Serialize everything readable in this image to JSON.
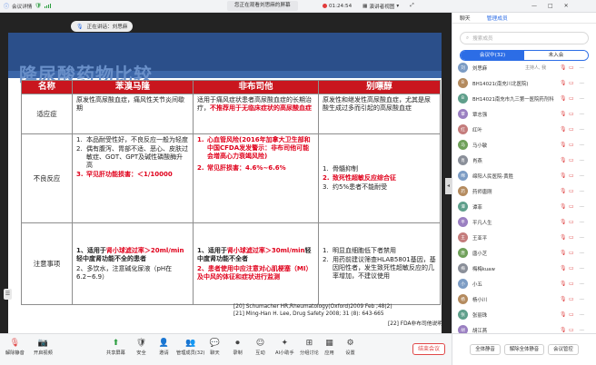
{
  "topbar": {
    "app_label": "会议详情",
    "center_status": "您正在观看刘思麻的屏幕",
    "time": "01:24:54",
    "layout": "演讲者视图",
    "wincontrols": [
      "—",
      "□",
      "✕"
    ]
  },
  "speaker": {
    "label": "正在讲话：刘思麻"
  },
  "slide": {
    "title": "降尿酸药物比较",
    "headers": [
      "名称",
      "苯溴马隆",
      "非布司他",
      "别嘌醇"
    ],
    "rows": [
      {
        "label": "适应症",
        "c1": "原发性高尿酸血症，痛风性关节炎间歇期",
        "c2_plain": "适用于痛风症状患者高尿酸血症的长期治疗，",
        "c2_red": "不推荐用于无临床症状的高尿酸血症",
        "c3": "原发性和继发性高尿酸血症，尤其是尿酸生成过多而引起的高尿酸血症"
      },
      {
        "label": "不良反应",
        "c1_items": [
          {
            "n": "1.",
            "t": "本品耐受性好，不良反应一般为轻度"
          },
          {
            "n": "2.",
            "t": "偶有腹泻、胃部不适、恶心、皮肤过敏症、GOT、GPT及碱性磷酸酶升高"
          },
          {
            "n": "3.",
            "t": "罕见肝功能损害：＜1/10000"
          }
        ],
        "c2_items": [
          {
            "n": "1.",
            "t": "心血管风险(2016年加拿大卫生部和中国CFDA发发警示：非布司他可能会增高心力衰竭风险)"
          },
          {
            "n": "2.",
            "t": "常见肝损害：4.6%~6.6%"
          }
        ],
        "c3_items": [
          {
            "n": "1.",
            "t": "骨髓抑制"
          },
          {
            "n": "2.",
            "t": "致死性超敏反应综合征"
          },
          {
            "n": "3.",
            "t": "约5%患者不能耐受"
          }
        ]
      },
      {
        "label": "注意事项",
        "c1_p1_pre": "1、适用于",
        "c1_p1_red": "肾小球滤过率＞20ml/min",
        "c1_p1_post": "轻中度肾功能不全的患者",
        "c1_p2": "2、多饮水，注意碱化尿液（pH在6.2~6.9）",
        "c2_p1_pre": "1、适用于",
        "c2_p1_red": "肾小球滤过率＞30ml/min",
        "c2_p1_post": "轻中度肾功能不全者",
        "c2_p2": "2、患者使用中应注意对心肌梗塞（MI）及中风的体征和症状进行监测",
        "c3_items": [
          {
            "n": "1.",
            "t": "明显血细胞低下者禁用"
          },
          {
            "n": "2.",
            "t": "用药前建议筛查HLAB5801基因，基因阳性者，发生致死性超敏反应的几率增加，不建议使用"
          }
        ]
      }
    ],
    "refs": [
      "[20] Schumacher HR,Rheumatology(Oxford)2009 Feb ;48(2)",
      "[21] Ming-Han H. Lee, Drug Safety 2008; 31 (8): 643-665"
    ],
    "ref3": "[22] FDA非布司他说明书"
  },
  "toolbar": {
    "items": [
      {
        "label": "解除静音",
        "icon": "mic-icon"
      },
      {
        "label": "开启视频",
        "icon": "camera-icon"
      },
      {
        "label": "共享屏幕",
        "icon": "share-icon"
      },
      {
        "label": "安全",
        "icon": "shield-icon"
      },
      {
        "label": "邀请",
        "icon": "invite-icon"
      },
      {
        "label": "管理成员(32)",
        "icon": "members-icon"
      },
      {
        "label": "聊天",
        "icon": "chat-icon"
      },
      {
        "label": "录制",
        "icon": "record-icon"
      },
      {
        "label": "互动",
        "icon": "interact-icon"
      },
      {
        "label": "AI小助手",
        "icon": "ai-icon"
      },
      {
        "label": "分组讨论",
        "icon": "group-icon"
      },
      {
        "label": "应用",
        "icon": "apps-icon"
      },
      {
        "label": "设置",
        "icon": "settings-icon"
      }
    ],
    "leave": "结束会议"
  },
  "panel": {
    "tabs": [
      "聊天",
      "管理成员"
    ],
    "search_placeholder": "搜索成员",
    "segments": [
      "会议中(32)",
      "未入会"
    ],
    "participants": [
      {
        "name": "刘思麻",
        "status": "主持人, 我",
        "avatar": "刘"
      },
      {
        "name": "BH14021(南充川北医院)",
        "status": "",
        "avatar": "B"
      },
      {
        "name": "BH14021南充市九三第一医院药剂科",
        "status": "",
        "avatar": "B"
      },
      {
        "name": "覃志强",
        "status": "",
        "avatar": "覃"
      },
      {
        "name": "红叶",
        "status": "",
        "avatar": "红"
      },
      {
        "name": "马小敏",
        "status": "",
        "avatar": "马"
      },
      {
        "name": "肖燕",
        "status": "",
        "avatar": "肖"
      },
      {
        "name": "绵阳人民医院-黄胜",
        "status": "",
        "avatar": "绵"
      },
      {
        "name": "药师唐刚",
        "status": "",
        "avatar": "药"
      },
      {
        "name": "谭菲",
        "status": "",
        "avatar": "谭"
      },
      {
        "name": "平凡人生",
        "status": "",
        "avatar": "平"
      },
      {
        "name": "王亚平",
        "status": "",
        "avatar": "王"
      },
      {
        "name": "唐小芝",
        "status": "",
        "avatar": "唐"
      },
      {
        "name": "梅梅kuaw",
        "status": "",
        "avatar": "梅"
      },
      {
        "name": "小五",
        "status": "",
        "avatar": "小"
      },
      {
        "name": "杨小川",
        "status": "",
        "avatar": "杨"
      },
      {
        "name": "张丽珠",
        "status": "",
        "avatar": "张"
      },
      {
        "name": "胡江燕",
        "status": "",
        "avatar": "胡"
      },
      {
        "name": "邓海峰",
        "status": "",
        "avatar": "邓"
      }
    ],
    "actions": [
      "全体静音",
      "解除全体静音",
      "会议管控"
    ]
  },
  "colors": {
    "header_red": "#c9161e",
    "accent_red": "#e0001b",
    "blue": "#2c6de6",
    "slide_header": "#2b4f8a"
  }
}
